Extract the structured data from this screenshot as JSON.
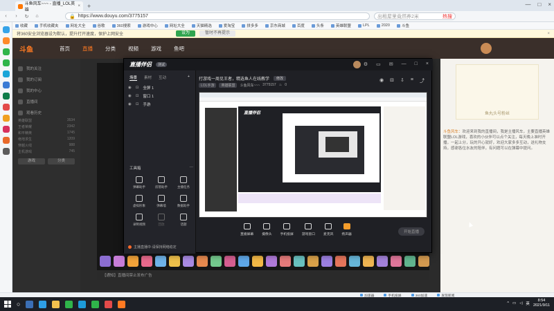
{
  "browser": {
    "tab_title": "斗鱼风车~~~ - 直播_LOL英雄",
    "tab_close": "×",
    "new_tab": "+",
    "url": "https://www.douyu.com/3775157",
    "search_placeholder": "出租屋里竟然养2米",
    "search_hot": "热搜",
    "bookmarks": [
      "收藏",
      "手机收藏夹",
      "网址大全",
      "谷歌",
      "360搜索",
      "游戏中心",
      "网址大全",
      "天猫精选",
      "爱淘宝",
      "拼多多",
      "京东商城",
      "百度",
      "头条",
      "英雄联盟",
      "LPL",
      "2020",
      "斗鱼"
    ],
    "notice_text": "将360安全浏览器设为默认，提升打开速度，保护上网安全",
    "notice_set": "设为",
    "notice_skip": "暂时不再提示",
    "notice_close": "×"
  },
  "site": {
    "logo": "斗鱼",
    "nav": [
      "首页",
      "直播",
      "分类",
      "视频",
      "游戏",
      "鱼吧"
    ],
    "active_nav": "直播",
    "left_nav": [
      "我的关注",
      "我的订阅",
      "我的中心",
      "直播间",
      "观看历史"
    ],
    "left_sections": [
      {
        "label": "英雄联盟",
        "value": "3534"
      },
      {
        "label": "王者荣耀",
        "value": "2342"
      },
      {
        "label": "和平精英",
        "value": "1745"
      },
      {
        "label": "绝地求生",
        "value": "1209"
      },
      {
        "label": "穿越火线",
        "value": "988"
      },
      {
        "label": "主机游戏",
        "value": "745"
      }
    ],
    "left_btns": [
      "游戏",
      "分类"
    ],
    "chat_card_text": "鱼丸头号粉丝",
    "chat_name": "斗鱼风车：",
    "chat_text": "欢迎来到我的直播间，我是主播风车，主要直播英雄联盟LOL游戏，喜欢的小伙伴可以点个关注，每天晚上准时开播，一起上分，玩的开心就好，欢迎大家多多互动，送礼物支持，感谢各位水友的陪伴，有问题可以在弹幕中提问。",
    "bottom_text": "【通知】直播间禁止发布广告"
  },
  "companion": {
    "brand": "直播伴侣",
    "version": "测试",
    "title_actions": [
      "⚙",
      "▭",
      "✉",
      "—",
      "□",
      "×"
    ],
    "tabs": [
      "场景",
      "素材",
      "互动"
    ],
    "active_tab": "场景",
    "scenes": [
      {
        "name": "全屏 1"
      },
      {
        "name": "窗口 1"
      },
      {
        "name": "手游"
      }
    ],
    "tools_title": "工具箱",
    "tools_more": "⋯",
    "tools": [
      {
        "label": "弹幕助手",
        "dim": false
      },
      {
        "label": "房管助手",
        "dim": false
      },
      {
        "label": "主播任务",
        "dim": false
      },
      {
        "label": "虚拟形象",
        "dim": false
      },
      {
        "label": "弹幕墙",
        "dim": false
      },
      {
        "label": "数据助手",
        "dim": false
      },
      {
        "label": "录制视频",
        "dim": false
      },
      {
        "label": "回放",
        "dim": true
      },
      {
        "label": "话题",
        "dim": false
      }
    ],
    "live_tip": "主播直播中·请保持网络稳定",
    "room_title": "打游戏一周见王者，精选鱼人在线教学",
    "room_edit": "修改",
    "room_category": "LOL手游",
    "room_sub": "英雄联盟",
    "room_owner": "斗鱼风车~~~",
    "room_id": "3775157",
    "room_count": "0",
    "right_icons": [
      "◉",
      "⊟",
      "⇩",
      "≡",
      "⤴"
    ],
    "preview_title": "直播伴侣",
    "controls": [
      {
        "label": "直播屏幕"
      },
      {
        "label": "摄像头"
      },
      {
        "label": "手机投屏"
      },
      {
        "label": "游戏窗口"
      },
      {
        "label": "麦克风"
      },
      {
        "label": "扬声器"
      }
    ],
    "start_btn": "开始直播"
  },
  "status": {
    "items": [
      "加速器",
      "手机投屏",
      "360加速",
      "发现新闻"
    ]
  },
  "taskbar": {
    "time": "8:54",
    "date": "2021/9/11",
    "lang": "英"
  }
}
